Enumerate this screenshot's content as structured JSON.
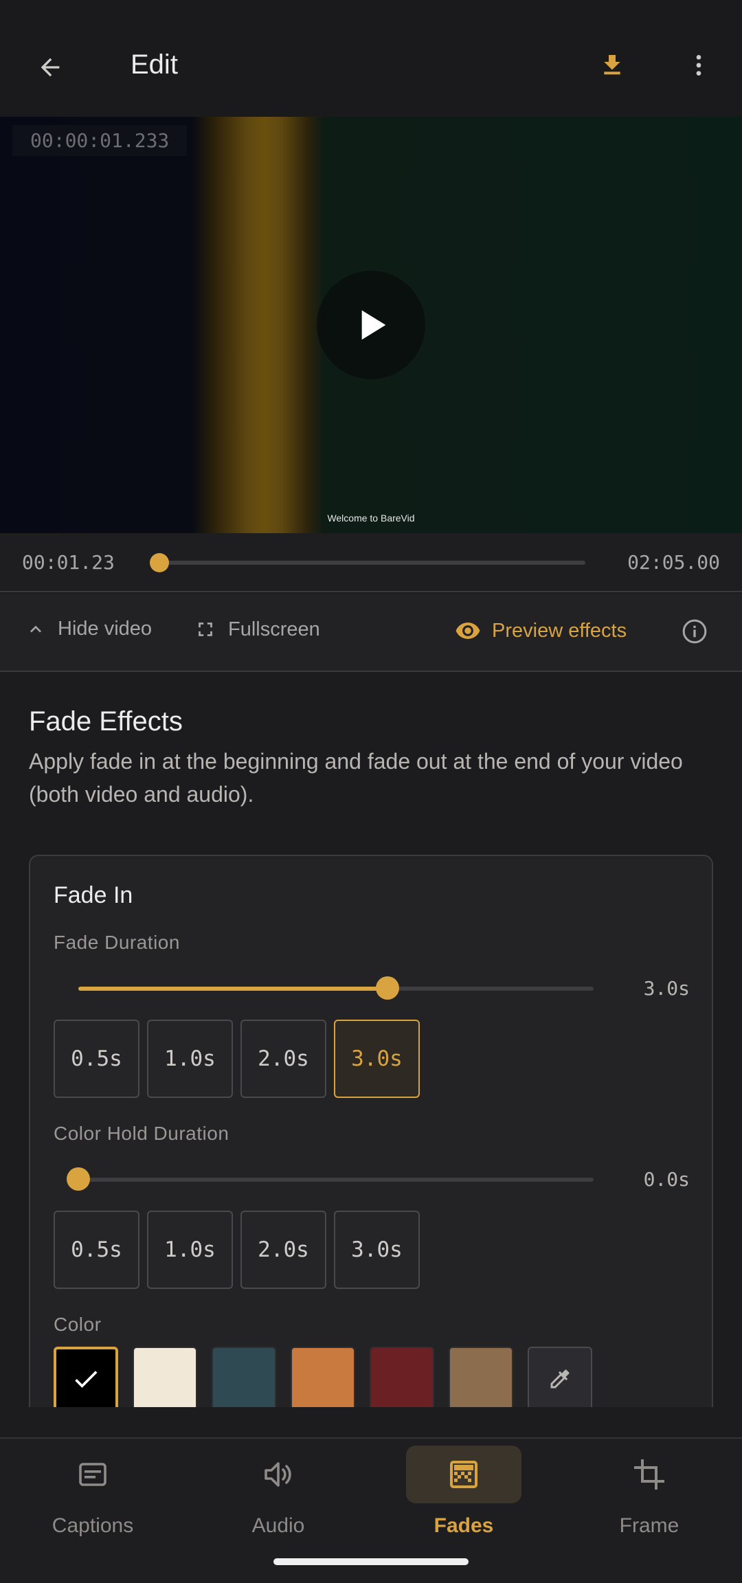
{
  "app_bar": {
    "title": "Edit"
  },
  "video": {
    "timecode_overlay": "00:00:01.233",
    "caption_text": "Welcome to BareVid"
  },
  "seek": {
    "current_time": "00:01.23",
    "duration": "02:05.00",
    "progress": 0.0098
  },
  "controls": {
    "hide_video": "Hide video",
    "fullscreen": "Fullscreen",
    "preview_effects": "Preview effects"
  },
  "section": {
    "title": "Fade Effects",
    "description": "Apply fade in at the beginning and fade out at the end of your video (both video and audio)."
  },
  "fade_in": {
    "title": "Fade In",
    "fade_duration": {
      "label": "Fade Duration",
      "value_text": "3.0s",
      "value": 3.0,
      "max": 5.0,
      "presets": [
        "0.5s",
        "1.0s",
        "2.0s",
        "3.0s"
      ],
      "selected_index": 3
    },
    "color_hold_duration": {
      "label": "Color Hold Duration",
      "value_text": "0.0s",
      "value": 0.0,
      "max": 5.0,
      "presets": [
        "0.5s",
        "1.0s",
        "2.0s",
        "3.0s"
      ],
      "selected_index": -1
    },
    "color": {
      "label": "Color",
      "swatches": [
        "#000000",
        "#f1e8d8",
        "#2f4a52",
        "#c97a3e",
        "#6b2124",
        "#8c6e4e"
      ],
      "selected_index": 0
    }
  },
  "bottom_nav": {
    "items": [
      {
        "label": "Captions",
        "icon": "captions-icon"
      },
      {
        "label": "Audio",
        "icon": "volume-icon"
      },
      {
        "label": "Fades",
        "icon": "fades-icon"
      },
      {
        "label": "Frame",
        "icon": "crop-icon"
      }
    ],
    "active_index": 2
  },
  "colors": {
    "accent": "#d9a440",
    "background": "#1c1c1f",
    "surface": "#232326"
  }
}
